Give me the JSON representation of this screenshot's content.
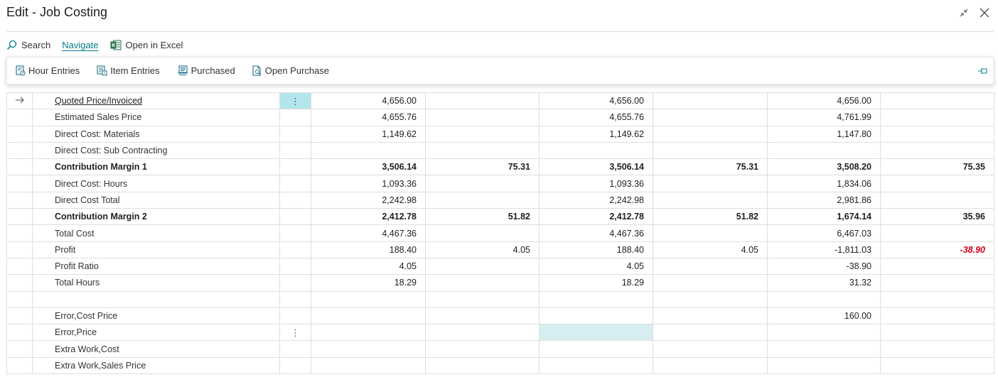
{
  "window": {
    "title": "Edit - Job Costing"
  },
  "actions": {
    "search": "Search",
    "navigate": "Navigate",
    "open_excel": "Open in Excel"
  },
  "subactions": {
    "hour_entries": "Hour Entries",
    "item_entries": "Item Entries",
    "purchased": "Purchased",
    "open_purchase": "Open Purchase"
  },
  "rows": [
    {
      "desc": "Quoted Price/Invoiced",
      "v1": "4,656.00",
      "r1": "",
      "v2": "4,656.00",
      "r2": "",
      "v3": "4,656.00",
      "r3": ""
    },
    {
      "desc": "Estimated Sales Price",
      "v1": "4,655.76",
      "r1": "",
      "v2": "4,655.76",
      "r2": "",
      "v3": "4,761.99",
      "r3": ""
    },
    {
      "desc": "Direct Cost: Materials",
      "v1": "1,149.62",
      "r1": "",
      "v2": "1,149.62",
      "r2": "",
      "v3": "1,147.80",
      "r3": ""
    },
    {
      "desc": "Direct Cost: Sub Contracting",
      "v1": "",
      "r1": "",
      "v2": "",
      "r2": "",
      "v3": "",
      "r3": ""
    },
    {
      "desc": "Contribution Margin 1",
      "v1": "3,506.14",
      "r1": "75.31",
      "v2": "3,506.14",
      "r2": "75.31",
      "v3": "3,508.20",
      "r3": "75.35"
    },
    {
      "desc": "Direct Cost: Hours",
      "v1": "1,093.36",
      "r1": "",
      "v2": "1,093.36",
      "r2": "",
      "v3": "1,834.06",
      "r3": ""
    },
    {
      "desc": "Direct Cost Total",
      "v1": "2,242.98",
      "r1": "",
      "v2": "2,242.98",
      "r2": "",
      "v3": "2,981.86",
      "r3": ""
    },
    {
      "desc": "Contribution Margin 2",
      "v1": "2,412.78",
      "r1": "51.82",
      "v2": "2,412.78",
      "r2": "51.82",
      "v3": "1,674.14",
      "r3": "35.96"
    },
    {
      "desc": "Total Cost",
      "v1": "4,467.36",
      "r1": "",
      "v2": "4,467.36",
      "r2": "",
      "v3": "6,467.03",
      "r3": ""
    },
    {
      "desc": "Profit",
      "v1": "188.40",
      "r1": "4.05",
      "v2": "188.40",
      "r2": "4.05",
      "v3": "-1,811.03",
      "r3": "-38.90"
    },
    {
      "desc": "Profit Ratio",
      "v1": "4.05",
      "r1": "",
      "v2": "4.05",
      "r2": "",
      "v3": "-38.90",
      "r3": ""
    },
    {
      "desc": "Total Hours",
      "v1": "18.29",
      "r1": "",
      "v2": "18.29",
      "r2": "",
      "v3": "31.32",
      "r3": ""
    },
    {
      "desc": "",
      "v1": "",
      "r1": "",
      "v2": "",
      "r2": "",
      "v3": "",
      "r3": ""
    },
    {
      "desc": "Error,Cost Price",
      "v1": "",
      "r1": "",
      "v2": "",
      "r2": "",
      "v3": "160.00",
      "r3": ""
    },
    {
      "desc": "Error,Price",
      "v1": "",
      "r1": "",
      "v2": "",
      "r2": "",
      "v3": "",
      "r3": ""
    },
    {
      "desc": "Extra Work,Cost",
      "v1": "",
      "r1": "",
      "v2": "",
      "r2": "",
      "v3": "",
      "r3": ""
    },
    {
      "desc": "Extra Work,Sales Price",
      "v1": "",
      "r1": "",
      "v2": "",
      "r2": "",
      "v3": "",
      "r3": ""
    }
  ],
  "icons": {
    "search": "search-icon",
    "excel": "excel-icon",
    "collapse": "collapse-icon",
    "close": "close-icon",
    "pin": "pin-icon",
    "row_arrow": "arrow-right-icon",
    "more": "more-vertical-icon"
  },
  "colors": {
    "accent": "#007c89",
    "negative": "#d0021b",
    "selected": "#b3e5ec"
  }
}
